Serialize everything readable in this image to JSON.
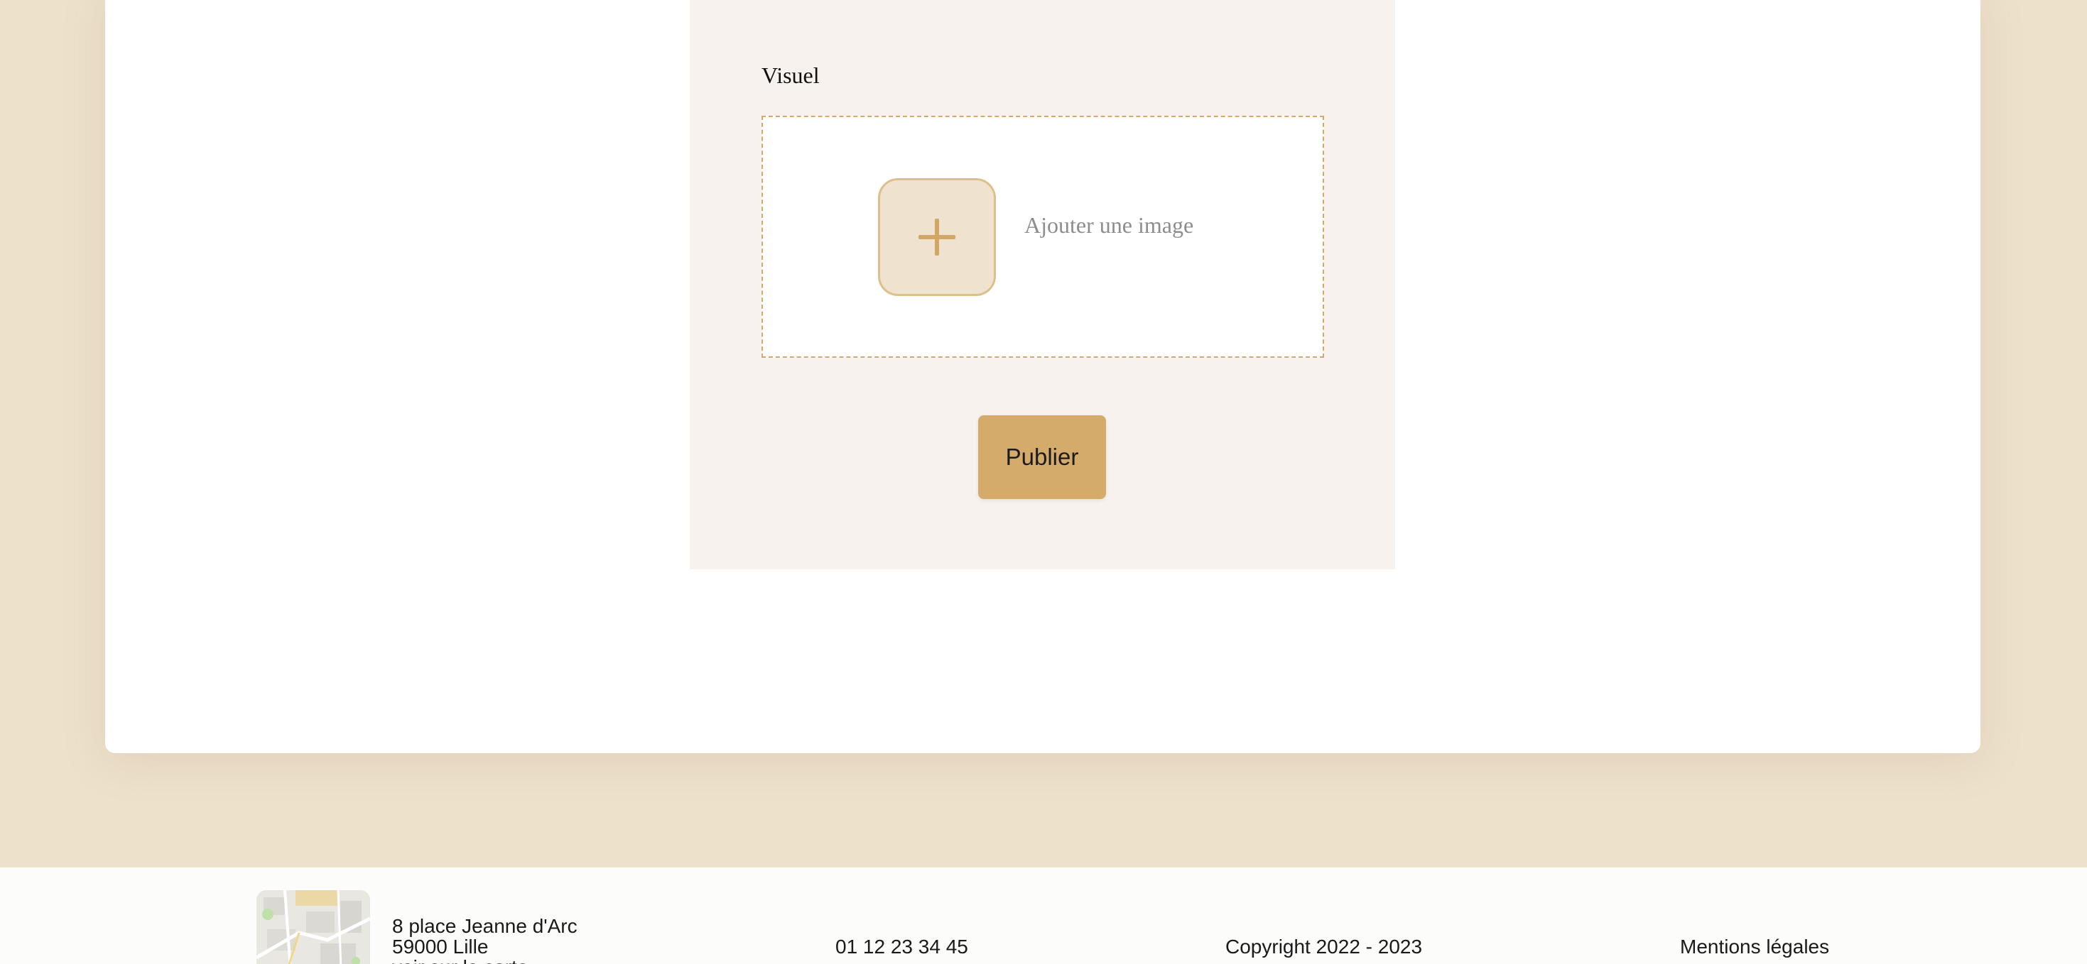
{
  "form": {
    "visual_label": "Visuel",
    "add_image_label": "Ajouter une image",
    "add_image_icon": "plus-icon",
    "publish_label": "Publier"
  },
  "footer": {
    "address_line1": "8 place Jeanne d'Arc",
    "address_line2": "59000 Lille",
    "address_line3": "voir sur la carte",
    "phone": "01 12 23 34 45",
    "copyright": "Copyright 2022 - 2023",
    "legal": "Mentions légales"
  },
  "colors": {
    "page_background": "#ede1cc",
    "form_panel": "#f7f2ed",
    "accent": "#d4ab6b",
    "dropzone_border": "#d9a866"
  }
}
